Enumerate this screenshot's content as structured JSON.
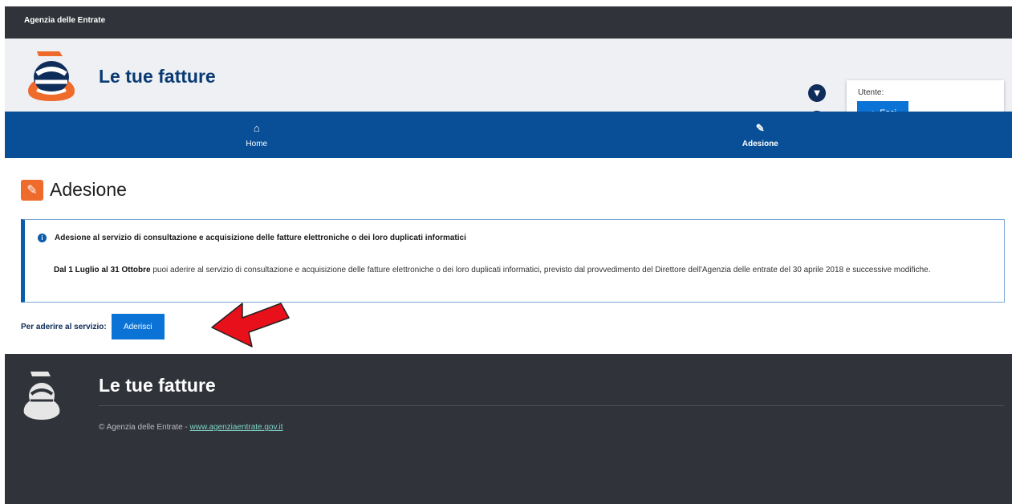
{
  "topbar": {
    "org_name": "Agenzia delle Entrate"
  },
  "header": {
    "app_title": "Le tue fatture",
    "user_label": "Utente:",
    "exit_label": "Esci"
  },
  "nav": {
    "items": [
      {
        "label": "Home",
        "icon": "home-icon",
        "active": false
      },
      {
        "label": "Adesione",
        "icon": "pencil-icon",
        "active": true
      }
    ]
  },
  "main": {
    "page_title": "Adesione",
    "notice": {
      "heading": "Adesione al servizio di consultazione e acquisizione delle fatture elettroniche o dei loro duplicati informatici",
      "body_bold": "Dal 1 Luglio al 31 Ottobre",
      "body_rest": " puoi aderire al servizio di consultazione e acquisizione delle fatture elettroniche o dei loro duplicati informatici, previsto dal provvedimento del Direttore dell'Agenzia delle entrate del 30 aprile 2018 e successive modifiche."
    },
    "join_label": "Per aderire al servizio:",
    "join_button": "Aderisci"
  },
  "footer": {
    "title": "Le tue fatture",
    "copyright": "© Agenzia delle Entrate - ",
    "link_text": "www.agenziaentrate.gov.it"
  },
  "colors": {
    "nav_blue": "#094f97",
    "button_blue": "#0b73d6",
    "dark_bar": "#30343a",
    "accent_orange": "#ef6b2b",
    "arrow_red": "#e8101a"
  }
}
